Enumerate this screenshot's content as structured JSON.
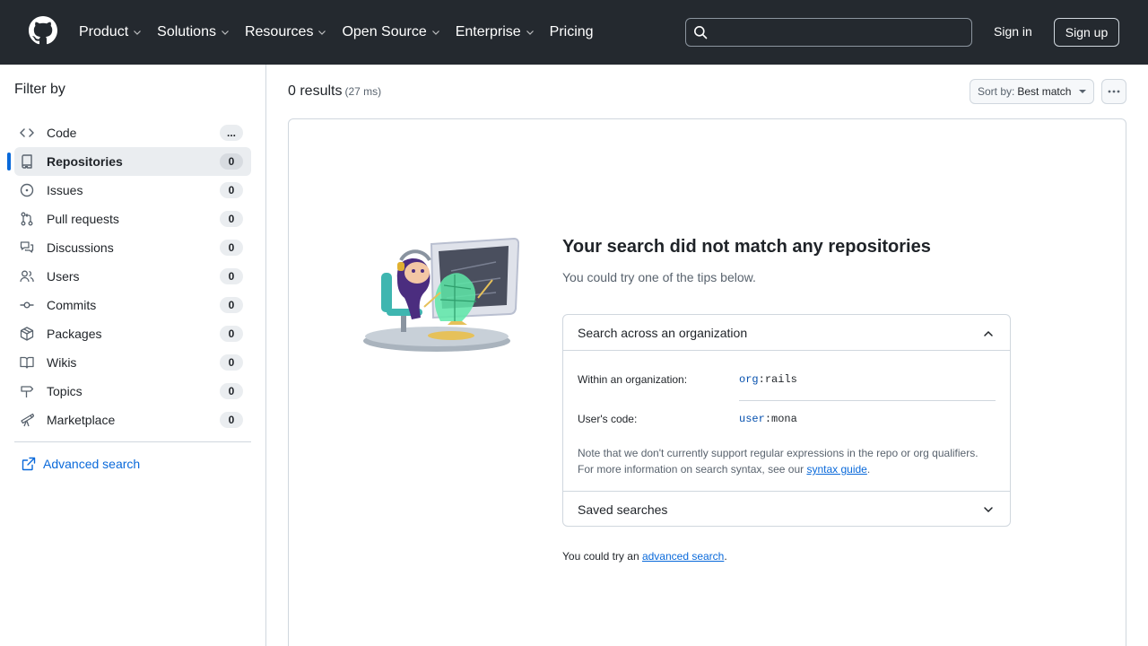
{
  "header": {
    "nav": [
      {
        "label": "Product",
        "dropdown": true
      },
      {
        "label": "Solutions",
        "dropdown": true
      },
      {
        "label": "Resources",
        "dropdown": true
      },
      {
        "label": "Open Source",
        "dropdown": true
      },
      {
        "label": "Enterprise",
        "dropdown": true
      },
      {
        "label": "Pricing",
        "dropdown": false
      }
    ],
    "search_value": "",
    "sign_in": "Sign in",
    "sign_up": "Sign up"
  },
  "sidebar": {
    "title": "Filter by",
    "items": [
      {
        "label": "Code",
        "count": "...",
        "icon": "code-icon",
        "active": false
      },
      {
        "label": "Repositories",
        "count": "0",
        "icon": "repo-icon",
        "active": true
      },
      {
        "label": "Issues",
        "count": "0",
        "icon": "issue-icon",
        "active": false
      },
      {
        "label": "Pull requests",
        "count": "0",
        "icon": "pull-request-icon",
        "active": false
      },
      {
        "label": "Discussions",
        "count": "0",
        "icon": "discussion-icon",
        "active": false
      },
      {
        "label": "Users",
        "count": "0",
        "icon": "people-icon",
        "active": false
      },
      {
        "label": "Commits",
        "count": "0",
        "icon": "commit-icon",
        "active": false
      },
      {
        "label": "Packages",
        "count": "0",
        "icon": "package-icon",
        "active": false
      },
      {
        "label": "Wikis",
        "count": "0",
        "icon": "book-icon",
        "active": false
      },
      {
        "label": "Topics",
        "count": "0",
        "icon": "topic-icon",
        "active": false
      },
      {
        "label": "Marketplace",
        "count": "0",
        "icon": "telescope-icon",
        "active": false
      }
    ],
    "advanced_search": "Advanced search"
  },
  "main": {
    "results": "0 results",
    "time": "(27 ms)",
    "sort_prefix": "Sort by:",
    "sort_value": "Best match",
    "empty_title": "Your search did not match any repositories",
    "empty_sub": "You could try one of the tips below.",
    "tips": {
      "org_header": "Search across an organization",
      "org_label": "Within an organization:",
      "org_key": "org",
      "org_value": "rails",
      "user_label": "User's code:",
      "user_key": "user",
      "user_value": "mona",
      "note_line1": "Note that we don't currently support regular expressions in the repo or org qualifiers.",
      "note_line2": "For more information on search syntax, see our ",
      "note_link": "syntax guide",
      "note_end": ".",
      "saved_header": "Saved searches"
    },
    "try_prefix": "You could try an ",
    "try_link": "advanced search",
    "try_end": "."
  },
  "colors": {
    "header_bg": "#24292f",
    "link": "#0969da",
    "accent": "#0969da",
    "border": "#d0d7de"
  }
}
